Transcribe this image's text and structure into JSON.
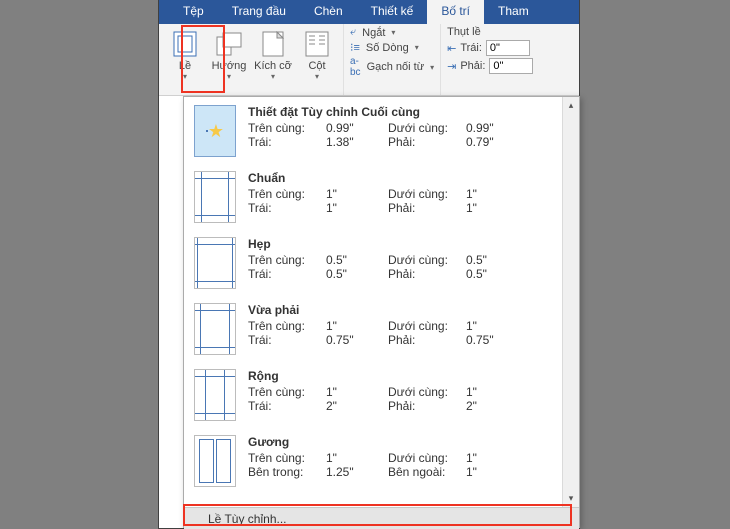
{
  "tabs": [
    "Tệp",
    "Trang đầu",
    "Chèn",
    "Thiết kế",
    "Bố trí",
    "Tham"
  ],
  "activeTab": 4,
  "ribbon": {
    "margins": "Lề",
    "orientation": "Hướng",
    "size": "Kích cỡ",
    "columns": "Cột",
    "breaks": "Ngắt",
    "lineNumbers": "Số Dòng",
    "hyphen": "Gạch nối từ",
    "indentTitle": "Thụt lề",
    "left": "Trái:",
    "right": "Phải:",
    "leftVal": "0\"",
    "rightVal": "0\""
  },
  "labels": {
    "top": "Trên cùng:",
    "bottom": "Dưới cùng:",
    "left": "Trái:",
    "right": "Phải:",
    "inside": "Bên trong:",
    "outside": "Bên ngoài:"
  },
  "presets": [
    {
      "name": "Thiết đặt Tùy chỉnh Cuối cùng",
      "key": "custom",
      "r1k": "top",
      "r1v": "0.99\"",
      "r2k": "bottom",
      "r2v": "0.99\"",
      "r3k": "left",
      "r3v": "1.38\"",
      "r4k": "right",
      "r4v": "0.79\""
    },
    {
      "name": "Chuẩn",
      "key": "normal",
      "r1k": "top",
      "r1v": "1\"",
      "r2k": "bottom",
      "r2v": "1\"",
      "r3k": "left",
      "r3v": "1\"",
      "r4k": "right",
      "r4v": "1\""
    },
    {
      "name": "Hẹp",
      "key": "narrow",
      "r1k": "top",
      "r1v": "0.5\"",
      "r2k": "bottom",
      "r2v": "0.5\"",
      "r3k": "left",
      "r3v": "0.5\"",
      "r4k": "right",
      "r4v": "0.5\""
    },
    {
      "name": "Vừa phải",
      "key": "moderate",
      "r1k": "top",
      "r1v": "1\"",
      "r2k": "bottom",
      "r2v": "1\"",
      "r3k": "left",
      "r3v": "0.75\"",
      "r4k": "right",
      "r4v": "0.75\""
    },
    {
      "name": "Rộng",
      "key": "wide",
      "r1k": "top",
      "r1v": "1\"",
      "r2k": "bottom",
      "r2v": "1\"",
      "r3k": "left",
      "r3v": "2\"",
      "r4k": "right",
      "r4v": "2\""
    },
    {
      "name": "Gương",
      "key": "mirror",
      "r1k": "top",
      "r1v": "1\"",
      "r2k": "bottom",
      "r2v": "1\"",
      "r3k": "inside",
      "r3v": "1.25\"",
      "r4k": "outside",
      "r4v": "1\""
    }
  ],
  "customMargins": "Lề Tùy chỉnh..."
}
